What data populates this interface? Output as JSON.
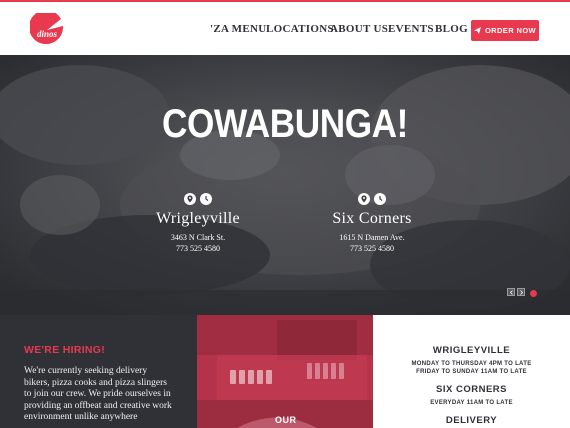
{
  "header": {
    "logo_text": "dinos",
    "nav": [
      {
        "label": "'ZA MENU"
      },
      {
        "label": "LOCATIONS"
      },
      {
        "label": "ABOUT US"
      },
      {
        "label": "EVENTS"
      },
      {
        "label": "BLOG"
      }
    ],
    "order_label": "ORDER NOW"
  },
  "hero": {
    "title": "COWABUNGA!",
    "locations": [
      {
        "name": "Wrigleyville",
        "address": "3463 N Clark St.",
        "phone": "773 525 4580"
      },
      {
        "name": "Six Corners",
        "address": "1615 N Damen Ave.",
        "phone": "773 525 4580"
      }
    ],
    "icons": [
      "map-pin-icon",
      "clock-icon"
    ]
  },
  "hiring": {
    "title": "WE'RE HIRING!",
    "text": "We're currently seeking delivery bikers, pizza cooks and pizza slingers to join our crew. We pride ourselves in providing an offbeat and creative work environment unlike anywhere"
  },
  "promo": {
    "text": "OUR"
  },
  "hours": {
    "sections": [
      {
        "heading": "WRIGLEYVILLE",
        "lines": [
          "MONDAY TO THURSDAY 4PM TO LATE",
          "FRIDAY TO SUNDAY 11AM TO LATE"
        ]
      },
      {
        "heading": "SIX CORNERS",
        "lines": [
          "EVERYDAY 11AM TO LATE"
        ]
      },
      {
        "heading": "DELIVERY",
        "lines": []
      }
    ]
  },
  "colors": {
    "accent": "#e8394f",
    "dark": "#2f3137",
    "promo": "#b5334a"
  }
}
